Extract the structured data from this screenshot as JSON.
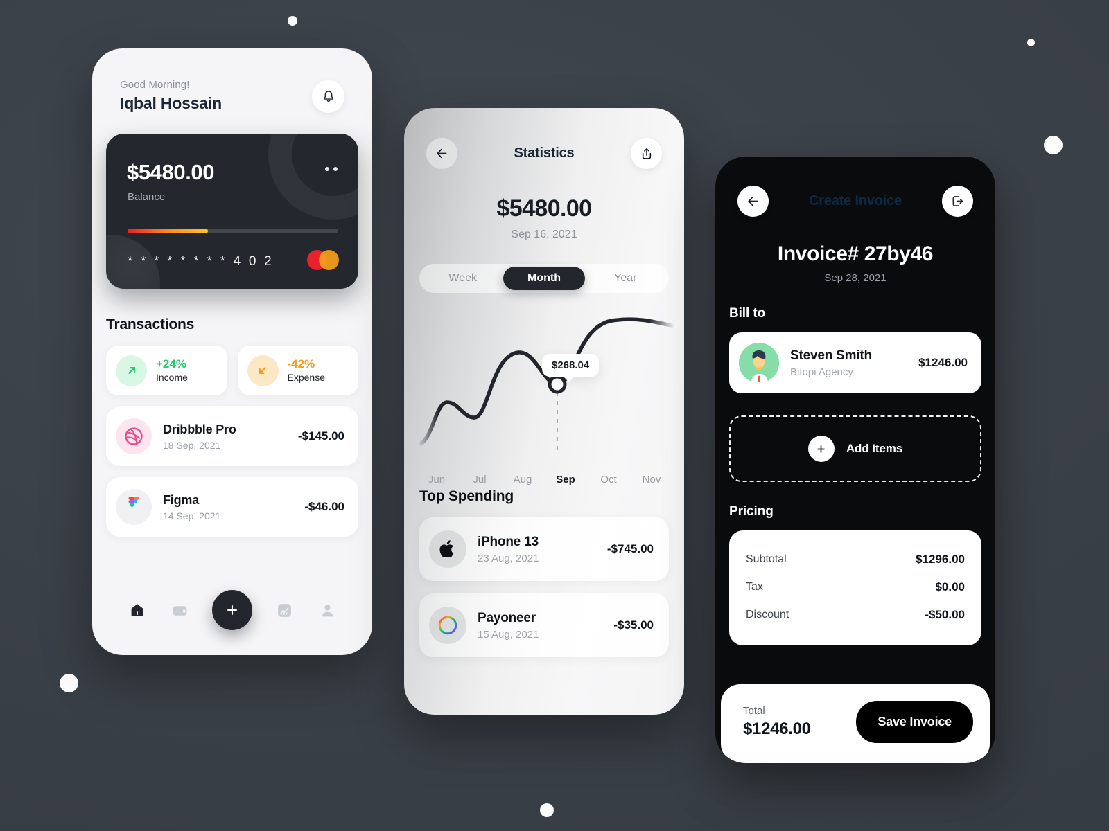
{
  "background": {
    "color": "#3a4047",
    "dot_color": "#fdfdfd"
  },
  "home": {
    "greeting": "Good Morning!",
    "user_name": "Iqbal Hossain",
    "notification_icon": "bell-icon",
    "card": {
      "amount": "$5480.00",
      "label": "Balance",
      "more_icon": "more-dots-icon",
      "number": "* * * *   * * * *   4 0 2",
      "brand_icon": "mastercard-icon",
      "progress_percent": 38
    },
    "transactions_title": "Transactions",
    "stats_pills": [
      {
        "icon": "arrow-up-right-icon",
        "percent": "+24%",
        "label": "Income",
        "tone": "up"
      },
      {
        "icon": "arrow-down-left-icon",
        "percent": "-42%",
        "label": "Expense",
        "tone": "down"
      }
    ],
    "transactions": [
      {
        "icon": "dribbble-icon",
        "name": "Dribbble Pro",
        "date": "18 Sep, 2021",
        "amount": "-$145.00"
      },
      {
        "icon": "figma-icon",
        "name": "Figma",
        "date": "14 Sep, 2021",
        "amount": "-$46.00"
      }
    ],
    "tabbar": [
      {
        "icon": "home-icon",
        "active": true
      },
      {
        "icon": "wallet-icon",
        "active": false
      },
      {
        "icon": "plus-icon",
        "active": false
      },
      {
        "icon": "chart-icon",
        "active": false
      },
      {
        "icon": "person-icon",
        "active": false
      }
    ]
  },
  "stats": {
    "back_icon": "arrow-left-icon",
    "title": "Statistics",
    "share_icon": "share-icon",
    "amount": "$5480.00",
    "date": "Sep 16, 2021",
    "segments": [
      {
        "label": "Week",
        "active": false
      },
      {
        "label": "Month",
        "active": true
      },
      {
        "label": "Year",
        "active": false
      }
    ],
    "tooltip": "$268.04",
    "top_spending_title": "Top Spending",
    "spending": [
      {
        "icon": "apple-icon",
        "name": "iPhone 13",
        "date": "23 Aug, 2021",
        "amount": "-$745.00"
      },
      {
        "icon": "payoneer-icon",
        "name": "Payoneer",
        "date": "15 Aug, 2021",
        "amount": "-$35.00"
      }
    ]
  },
  "invoice": {
    "back_icon": "arrow-left-icon",
    "title": "Create Invoice",
    "logout_icon": "logout-icon",
    "number": "Invoice# 27by46",
    "date": "Sep 28, 2021",
    "bill_to_title": "Bill to",
    "client": {
      "avatar": "person-avatar",
      "name": "Steven Smith",
      "company": "Bitopi Agency",
      "amount": "$1246.00"
    },
    "add_items_label": "Add Items",
    "add_items_icon": "plus-icon",
    "pricing_title": "Pricing",
    "pricing": [
      {
        "label": "Subtotal",
        "value": "$1296.00"
      },
      {
        "label": "Tax",
        "value": "$0.00"
      },
      {
        "label": "Discount",
        "value": "-$50.00"
      }
    ],
    "total_label": "Total",
    "total_value": "$1246.00",
    "save_label": "Save Invoice"
  },
  "chart_data": {
    "type": "line",
    "title": "Statistics",
    "categories": [
      "Jun",
      "Jul",
      "Aug",
      "Sep",
      "Oct",
      "Nov"
    ],
    "values": [
      60,
      130,
      205,
      135,
      235,
      240
    ],
    "highlight": {
      "category": "Sep",
      "label": "$268.04",
      "value": 268.04
    },
    "xlabel": "",
    "ylabel": "",
    "grid": false,
    "legend": "none",
    "line_color": "#22262c",
    "point_marker": "hollow-circle"
  }
}
